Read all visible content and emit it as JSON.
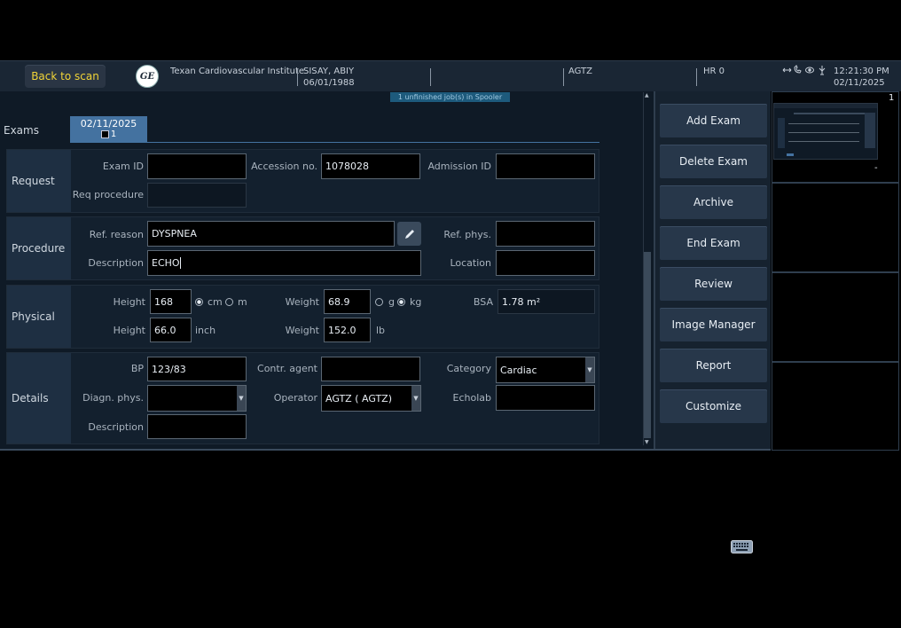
{
  "topbar": {
    "back_label": "Back to scan",
    "logo_text": "GE",
    "institute": "Texan Cardiovascular Institute",
    "patient_name": "SISAY, ABIY",
    "patient_dob": "06/01/1988",
    "operator": "AGTZ",
    "hr": "HR 0",
    "time": "12:21:30 PM",
    "date": "02/11/2025"
  },
  "spooler": "1 unfinished job(s) in Spooler",
  "exams": {
    "label": "Exams",
    "tab_date": "02/11/2025",
    "tab_count": "1"
  },
  "request": {
    "section_label": "Request",
    "exam_id_label": "Exam ID",
    "exam_id": "",
    "accession_label": "Accession no.",
    "accession": "1078028",
    "admission_label": "Admission ID",
    "admission": "",
    "req_proc_label": "Req procedure",
    "req_proc": ""
  },
  "procedure": {
    "section_label": "Procedure",
    "ref_reason_label": "Ref. reason",
    "ref_reason": "DYSPNEA",
    "ref_phys_label": "Ref. phys.",
    "ref_phys": "",
    "description_label": "Description",
    "description": "ECHO",
    "location_label": "Location",
    "location": ""
  },
  "physical": {
    "section_label": "Physical",
    "height_label": "Height",
    "height_cm": "168",
    "unit_cm": "cm",
    "unit_m": "m",
    "height_in": "66.0",
    "unit_inch": "inch",
    "weight_label": "Weight",
    "weight_kg": "68.9",
    "unit_g": "g",
    "unit_kg": "kg",
    "weight_lb": "152.0",
    "unit_lb": "lb",
    "bsa_label": "BSA",
    "bsa": "1.78 m²"
  },
  "details": {
    "section_label": "Details",
    "bp_label": "BP",
    "bp": "123/83",
    "contr_label": "Contr. agent",
    "contr": "",
    "category_label": "Category",
    "category": "Cardiac",
    "diagn_label": "Diagn. phys.",
    "diagn": "",
    "operator_label": "Operator",
    "operator": "AGTZ ( AGTZ)",
    "echolab_label": "Echolab",
    "echolab": "",
    "description_label": "Description",
    "description": ""
  },
  "actions": [
    "Add Exam",
    "Delete Exam",
    "Archive",
    "End Exam",
    "Review",
    "Image Manager",
    "Report",
    "Customize"
  ],
  "thumbnail": {
    "index": "1",
    "marker": "-"
  }
}
